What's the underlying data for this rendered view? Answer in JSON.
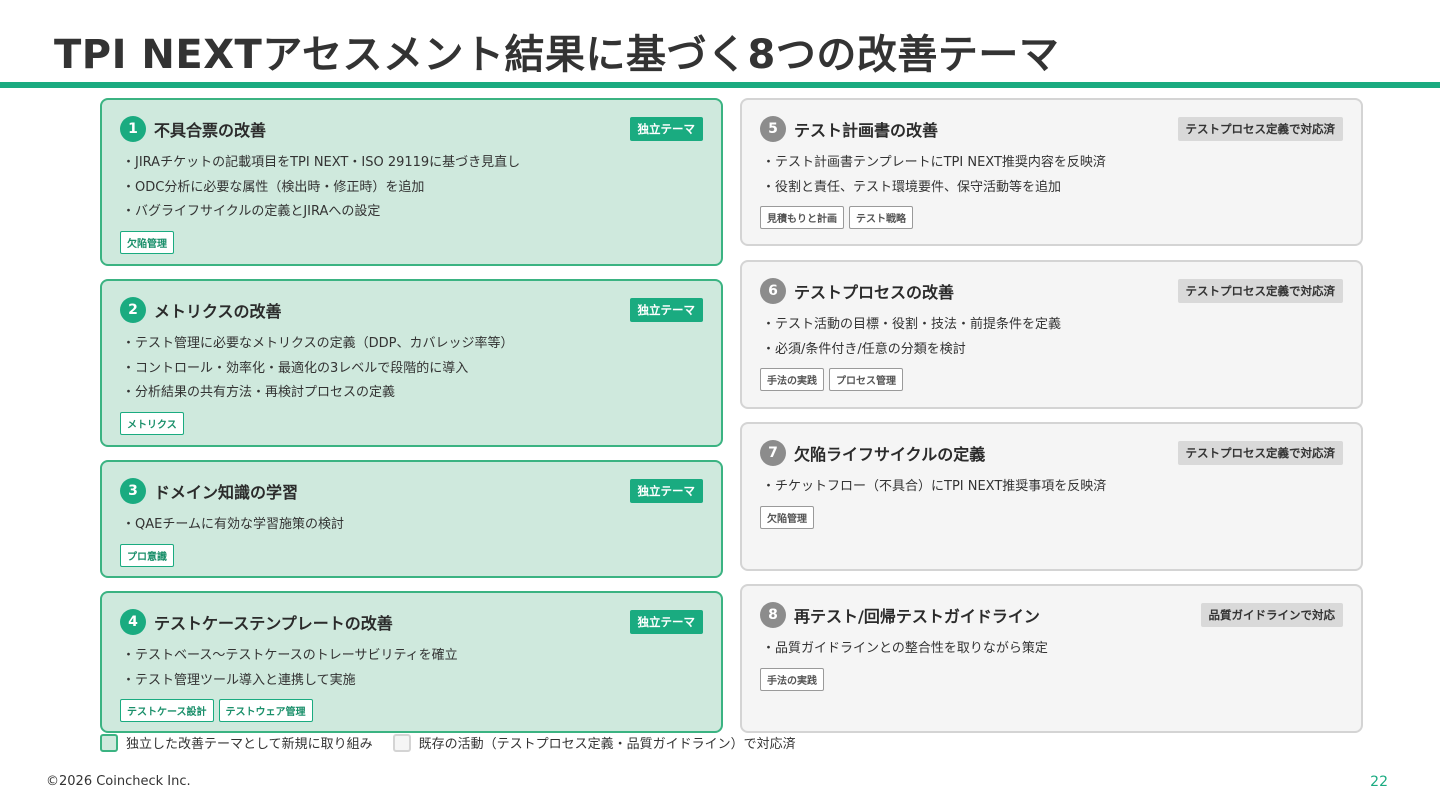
{
  "page": {
    "title": "TPI NEXTアセスメント結果に基づく8つの改善テーマ",
    "copyright": "©2026 Coincheck Inc.",
    "page_number": "22"
  },
  "colors": {
    "accent": "#1aab80",
    "green_fill": "#cfe9dd",
    "gray_fill": "#f5f5f5"
  },
  "left_cards": [
    {
      "number": "1",
      "title": "不具合票の改善",
      "badge": "独立テーマ",
      "items": [
        "・JIRAチケットの記載項目をTPI NEXT・ISO 29119に基づき見直し",
        "・ODC分析に必要な属性（検出時・修正時）を追加",
        "・バグライフサイクルの定義とJIRAへの設定"
      ],
      "tags": [
        "欠陥管理"
      ]
    },
    {
      "number": "2",
      "title": "メトリクスの改善",
      "badge": "独立テーマ",
      "items": [
        "・テスト管理に必要なメトリクスの定義（DDP、カバレッジ率等）",
        "・コントロール・効率化・最適化の3レベルで段階的に導入",
        "・分析結果の共有方法・再検討プロセスの定義"
      ],
      "tags": [
        "メトリクス"
      ]
    },
    {
      "number": "3",
      "title": "ドメイン知識の学習",
      "badge": "独立テーマ",
      "items": [
        "・QAEチームに有効な学習施策の検討"
      ],
      "tags": [
        "プロ意識"
      ]
    },
    {
      "number": "4",
      "title": "テストケーステンプレートの改善",
      "badge": "独立テーマ",
      "items": [
        "・テストベース〜テストケースのトレーサビリティを確立",
        "・テスト管理ツール導入と連携して実施"
      ],
      "tags": [
        "テストケース設計",
        "テストウェア管理"
      ]
    }
  ],
  "right_cards": [
    {
      "number": "5",
      "title": "テスト計画書の改善",
      "badge": "テストプロセス定義で対応済",
      "items": [
        "・テスト計画書テンプレートにTPI NEXT推奨内容を反映済",
        "・役割と責任、テスト環境要件、保守活動等を追加"
      ],
      "tags": [
        "見積もりと計画",
        "テスト戦略"
      ]
    },
    {
      "number": "6",
      "title": "テストプロセスの改善",
      "badge": "テストプロセス定義で対応済",
      "items": [
        "・テスト活動の目標・役割・技法・前提条件を定義",
        "・必須/条件付き/任意の分類を検討"
      ],
      "tags": [
        "手法の実践",
        "プロセス管理"
      ]
    },
    {
      "number": "7",
      "title": "欠陥ライフサイクルの定義",
      "badge": "テストプロセス定義で対応済",
      "items": [
        "・チケットフロー（不具合）にTPI NEXT推奨事項を反映済"
      ],
      "tags": [
        "欠陥管理"
      ]
    },
    {
      "number": "8",
      "title": "再テスト/回帰テストガイドライン",
      "badge": "品質ガイドラインで対応",
      "items": [
        "・品質ガイドラインとの整合性を取りながら策定"
      ],
      "tags": [
        "手法の実践"
      ]
    }
  ],
  "legend": {
    "new_label": "独立した改善テーマとして新規に取り組み",
    "existing_label": "既存の活動（テストプロセス定義・品質ガイドライン）で対応済"
  }
}
